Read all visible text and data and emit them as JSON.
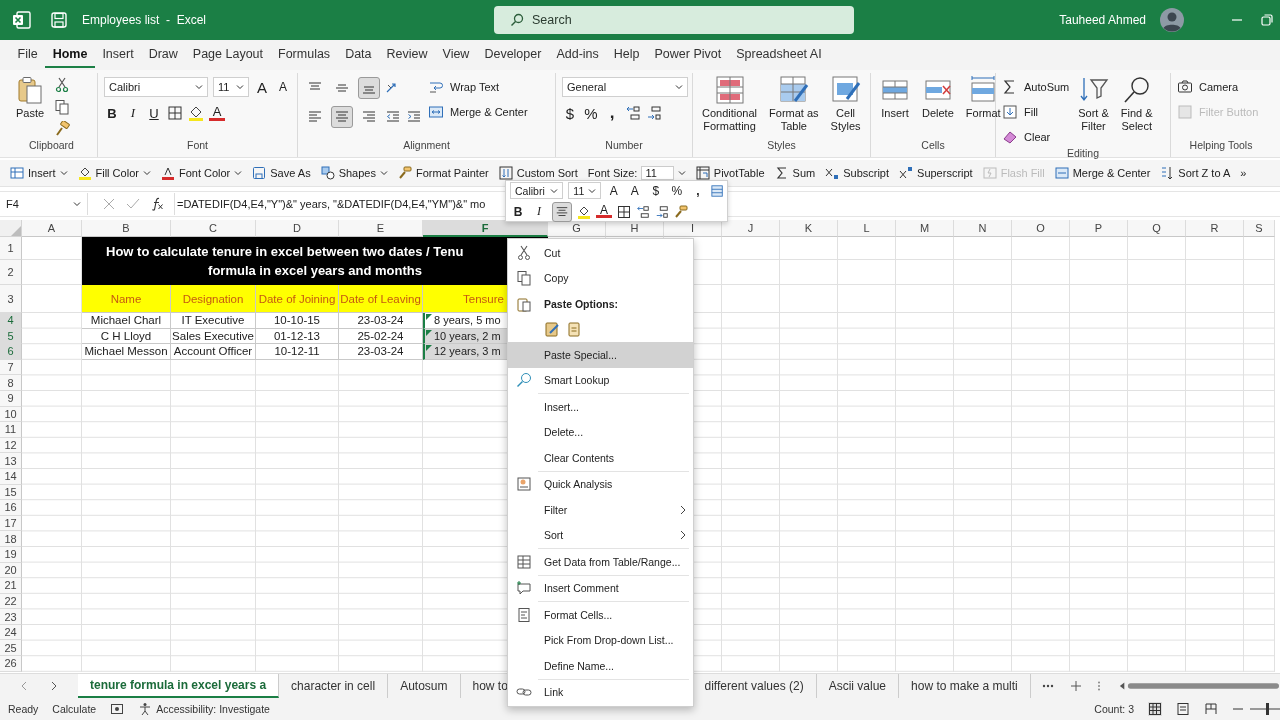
{
  "title_bar": {
    "document": "Employees list",
    "separator": "-",
    "app": "Excel",
    "search_placeholder": "Search",
    "user": "Tauheed Ahmed"
  },
  "menu_tabs": [
    {
      "label": "File",
      "selected": false
    },
    {
      "label": "Home",
      "selected": true
    },
    {
      "label": "Insert",
      "selected": false
    },
    {
      "label": "Draw",
      "selected": false
    },
    {
      "label": "Page Layout",
      "selected": false
    },
    {
      "label": "Formulas",
      "selected": false
    },
    {
      "label": "Data",
      "selected": false
    },
    {
      "label": "Review",
      "selected": false
    },
    {
      "label": "View",
      "selected": false
    },
    {
      "label": "Developer",
      "selected": false
    },
    {
      "label": "Add-ins",
      "selected": false
    },
    {
      "label": "Help",
      "selected": false
    },
    {
      "label": "Power Pivot",
      "selected": false
    },
    {
      "label": "Spreadsheet AI",
      "selected": false
    }
  ],
  "ribbon": {
    "clipboard": {
      "paste": "Paste",
      "label": "Clipboard"
    },
    "font": {
      "family": "Calibri",
      "size": "11",
      "grow": "A",
      "shrink": "A",
      "bold": "B",
      "italic": "I",
      "underline": "U",
      "font_color": "A",
      "label": "Font"
    },
    "alignment": {
      "vertical_buttons": [
        {
          "pressed": false
        },
        {
          "pressed": false
        },
        {
          "pressed": true
        }
      ],
      "horizontal_buttons": [
        {
          "pressed": false
        },
        {
          "pressed": true
        },
        {
          "pressed": false
        }
      ],
      "wrap_text": "Wrap Text",
      "merge_center": "Merge & Center",
      "label": "Alignment"
    },
    "number": {
      "format": "General",
      "currency": "$",
      "percent": "%",
      "comma": ",",
      "label": "Number"
    },
    "styles": {
      "conditional_formatting": "Conditional\nFormatting",
      "format_as_table": "Format as\nTable",
      "cell_styles": "Cell\nStyles",
      "label": "Styles"
    },
    "cells": {
      "insert": "Insert",
      "delete": "Delete",
      "format": "Format",
      "label": "Cells"
    },
    "editing": {
      "autosum": "AutoSum",
      "fill": "Fill",
      "clear": "Clear",
      "sort_filter": "Sort &\nFilter",
      "find_select": "Find &\nSelect",
      "label": "Editing"
    },
    "helping_tools": {
      "camera": "Camera",
      "filter_button": "Filter Button",
      "filter_button_disabled": true,
      "label": "Helping Tools"
    }
  },
  "quick_toolbar": [
    {
      "label": "Insert",
      "kind": "insert",
      "dropdown": true,
      "disabled": false
    },
    {
      "label": "Fill Color",
      "kind": "fill",
      "dropdown": true,
      "disabled": false
    },
    {
      "label": "Font Color",
      "kind": "fontcolor",
      "dropdown": true,
      "disabled": false
    },
    {
      "label": "Save As",
      "kind": "save",
      "dropdown": false,
      "disabled": false
    },
    {
      "label": "Shapes",
      "kind": "shapes",
      "dropdown": true,
      "disabled": false
    },
    {
      "label": "Format Painter",
      "kind": "painter",
      "dropdown": false,
      "disabled": false
    },
    {
      "label": "Custom Sort",
      "kind": "sort",
      "dropdown": false,
      "disabled": false
    },
    {
      "label": "Font Size:",
      "kind": "combo",
      "value": "11",
      "dropdown": true,
      "disabled": false
    },
    {
      "label": "PivotTable",
      "kind": "pivot",
      "dropdown": false,
      "disabled": false
    },
    {
      "label": "Sum",
      "kind": "sum",
      "dropdown": false,
      "disabled": false
    },
    {
      "label": "Subscript",
      "kind": "subscript",
      "dropdown": false,
      "disabled": false
    },
    {
      "label": "Superscript",
      "kind": "superscript",
      "dropdown": false,
      "disabled": false
    },
    {
      "label": "Flash Fill",
      "kind": "flashfill",
      "dropdown": false,
      "disabled": true
    },
    {
      "label": "Merge & Center",
      "kind": "merge",
      "dropdown": false,
      "disabled": false
    },
    {
      "label": "Sort Z to A",
      "kind": "sortza",
      "dropdown": false,
      "disabled": false
    },
    {
      "label": "»",
      "kind": "more",
      "dropdown": false,
      "disabled": false
    }
  ],
  "formula_bar": {
    "name_box": "F4",
    "formula": "=DATEDIF(D4,E4,\"Y\")&\" years, \"&DATEDIF(D4,E4,\"YM\")&\" mo"
  },
  "sheet": {
    "columns": [
      {
        "label": "A",
        "selected": false
      },
      {
        "label": "B",
        "selected": false
      },
      {
        "label": "C",
        "selected": false
      },
      {
        "label": "D",
        "selected": false
      },
      {
        "label": "E",
        "selected": false
      },
      {
        "label": "F",
        "selected": true
      },
      {
        "label": "G",
        "selected": false
      },
      {
        "label": "H",
        "selected": false
      },
      {
        "label": "I",
        "selected": false
      },
      {
        "label": "J",
        "selected": false
      },
      {
        "label": "K",
        "selected": false
      },
      {
        "label": "L",
        "selected": false
      },
      {
        "label": "M",
        "selected": false
      },
      {
        "label": "N",
        "selected": false
      },
      {
        "label": "O",
        "selected": false
      },
      {
        "label": "P",
        "selected": false
      },
      {
        "label": "Q",
        "selected": false
      },
      {
        "label": "R",
        "selected": false
      },
      {
        "label": "S",
        "selected": false
      }
    ],
    "rows": [
      {
        "label": "1",
        "selected": false
      },
      {
        "label": "2",
        "selected": false
      },
      {
        "label": "3",
        "selected": false
      },
      {
        "label": "4",
        "selected": true
      },
      {
        "label": "5",
        "selected": true
      },
      {
        "label": "6",
        "selected": true
      },
      {
        "label": "7",
        "selected": false
      },
      {
        "label": "8",
        "selected": false
      },
      {
        "label": "9",
        "selected": false
      },
      {
        "label": "10",
        "selected": false
      },
      {
        "label": "11",
        "selected": false
      },
      {
        "label": "12",
        "selected": false
      },
      {
        "label": "13",
        "selected": false
      },
      {
        "label": "14",
        "selected": false
      },
      {
        "label": "15",
        "selected": false
      },
      {
        "label": "16",
        "selected": false
      },
      {
        "label": "17",
        "selected": false
      },
      {
        "label": "18",
        "selected": false
      },
      {
        "label": "19",
        "selected": false
      },
      {
        "label": "20",
        "selected": false
      },
      {
        "label": "21",
        "selected": false
      },
      {
        "label": "22",
        "selected": false
      },
      {
        "label": "23",
        "selected": false
      },
      {
        "label": "24",
        "selected": false
      },
      {
        "label": "25",
        "selected": false
      },
      {
        "label": "26",
        "selected": false
      }
    ],
    "title_lines": [
      "How to calculate tenure in excel between two dates / Tenu",
      "formula in excel years and months"
    ],
    "headers": [
      "Name",
      "Designation",
      "Date of Joining",
      "Date of Leaving",
      "Tensure"
    ],
    "records": [
      {
        "cells": [
          "Michael Charl",
          "IT Executive",
          "10-10-15",
          "23-03-24",
          "8 years, 5 mo"
        ],
        "selected": true,
        "active": true
      },
      {
        "cells": [
          "C H Lloyd",
          "Sales Executive",
          "01-12-13",
          "25-02-24",
          "10 years, 2 m"
        ],
        "selected": true,
        "active": false
      },
      {
        "cells": [
          "Michael Messon",
          "Account Officer",
          "10-12-11",
          "23-03-24",
          "12 years, 3 m"
        ],
        "selected": true,
        "active": false
      }
    ]
  },
  "mini_toolbar": {
    "font": "Calibri",
    "size": "11",
    "grow": "A",
    "shrink": "A",
    "currency": "$",
    "percent": "%",
    "comma": ",",
    "bold": "B",
    "italic": "I",
    "font_color": "A",
    "center_pressed": true
  },
  "context_menu": [
    {
      "label": "Cut",
      "kind": "cut",
      "selected": false,
      "submenu": false
    },
    {
      "label": "Copy",
      "kind": "copy",
      "selected": false,
      "submenu": false
    },
    {
      "label": "Paste Options:",
      "kind": "heading",
      "selected": false,
      "submenu": false
    },
    {
      "kind": "paste_icons",
      "selected": false,
      "submenu": false
    },
    {
      "label": "Paste Special...",
      "kind": "plain",
      "selected": true,
      "submenu": false
    },
    {
      "label": "Smart Lookup",
      "kind": "lookup",
      "selected": false,
      "submenu": false,
      "divider": true
    },
    {
      "label": "Insert...",
      "kind": "plain",
      "selected": false,
      "submenu": false
    },
    {
      "label": "Delete...",
      "kind": "plain",
      "selected": false,
      "submenu": false
    },
    {
      "label": "Clear Contents",
      "kind": "plain",
      "selected": false,
      "submenu": false,
      "divider": true
    },
    {
      "label": "Quick Analysis",
      "kind": "analysis",
      "selected": false,
      "submenu": false
    },
    {
      "label": "Filter",
      "kind": "plain",
      "selected": false,
      "submenu": true
    },
    {
      "label": "Sort",
      "kind": "plain",
      "selected": false,
      "submenu": true,
      "divider": true
    },
    {
      "label": "Get Data from Table/Range...",
      "kind": "table",
      "selected": false,
      "submenu": false,
      "divider": true
    },
    {
      "label": "Insert Comment",
      "kind": "comment",
      "selected": false,
      "submenu": false,
      "divider": true
    },
    {
      "label": "Format Cells...",
      "kind": "format",
      "selected": false,
      "submenu": false
    },
    {
      "label": "Pick From Drop-down List...",
      "kind": "plain",
      "selected": false,
      "submenu": false
    },
    {
      "label": "Define Name...",
      "kind": "plain",
      "selected": false,
      "submenu": false,
      "divider": true
    },
    {
      "label": "Link",
      "kind": "link",
      "selected": false,
      "submenu": false
    }
  ],
  "sheet_tabs": [
    {
      "label": "tenure formula in excel years a",
      "selected": true
    },
    {
      "label": "character in cell",
      "selected": false
    },
    {
      "label": "Autosum",
      "selected": false
    },
    {
      "label": "how to",
      "selected": false
    },
    {
      "label": "different values  (2)",
      "selected": false
    },
    {
      "label": "Ascii value",
      "selected": false
    },
    {
      "label": "how to make a multi",
      "selected": false
    }
  ],
  "status_bar": {
    "mode": "Ready",
    "calculate": "Calculate",
    "accessibility": "Accessibility: Investigate",
    "count": "Count: 3",
    "zoom": {
      "level": 0.6
    }
  }
}
